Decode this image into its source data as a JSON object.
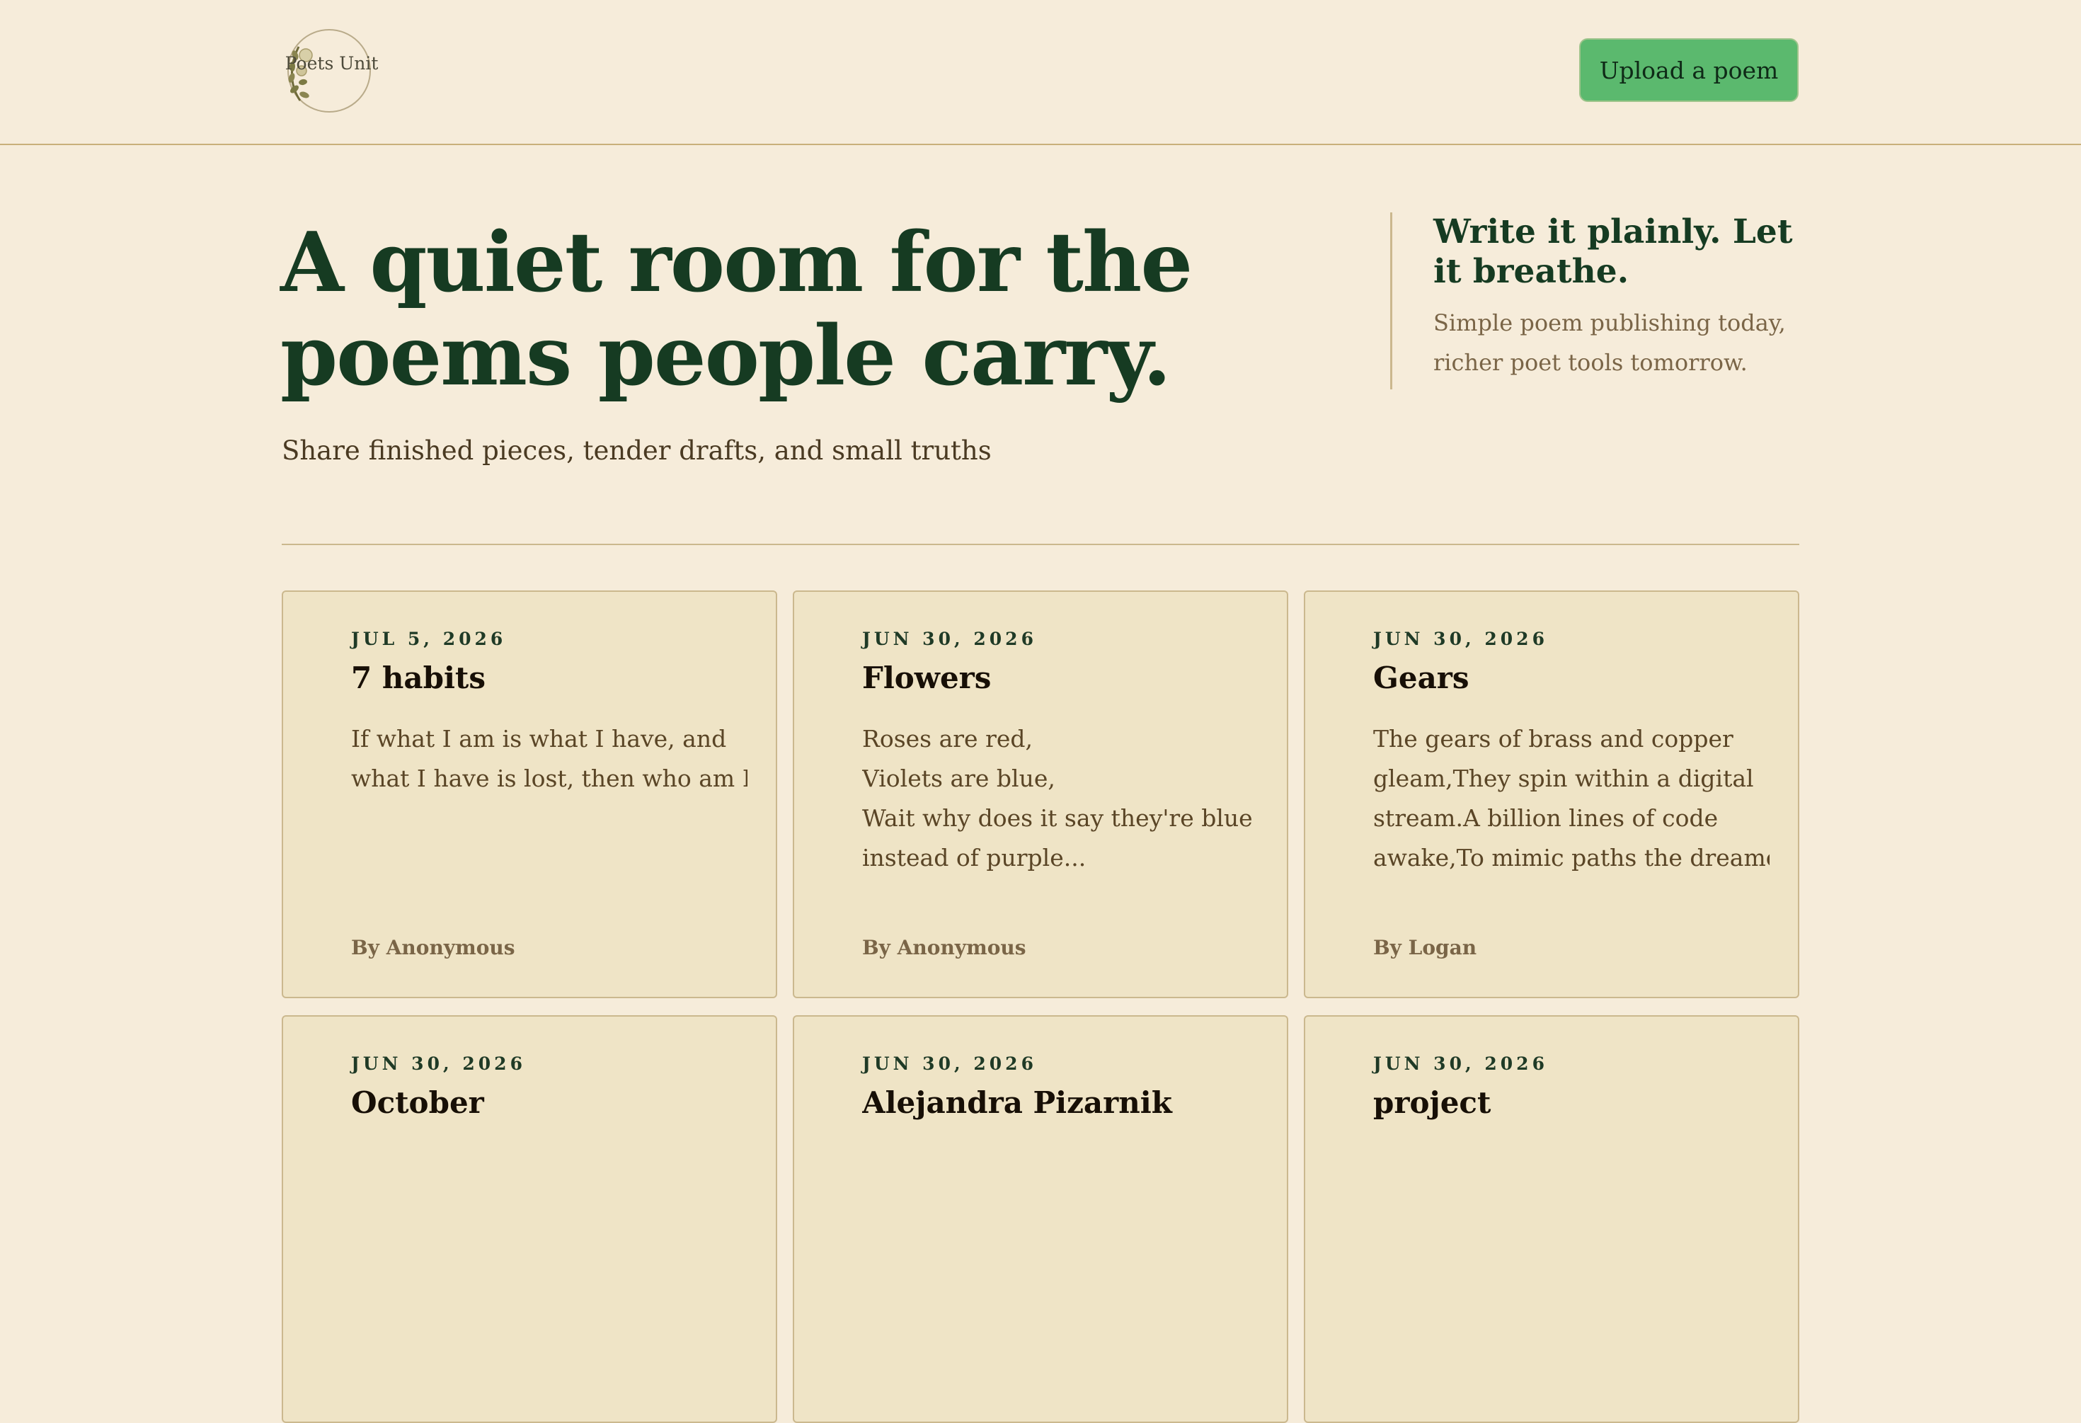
{
  "header": {
    "logo_text": "Poets United",
    "upload_label": "Upload a poem"
  },
  "hero": {
    "title_line1": "A quiet room for the",
    "title_line2": "poems people carry.",
    "subtitle": "Share finished pieces, tender drafts, and small truths"
  },
  "side_note": {
    "title_line1": "Write it plainly. Let",
    "title_line2": "it breathe.",
    "text_line1": "Simple poem publishing today,",
    "text_line2": "richer poet tools tomorrow."
  },
  "poems": [
    {
      "date": "JUL 5, 2026",
      "title": "7 habits",
      "lines": [
        "If what I am is what I have, and",
        "what I have is lost, then who am I?"
      ],
      "author": "By Anonymous"
    },
    {
      "date": "JUN 30, 2026",
      "title": "Flowers",
      "lines": [
        "Roses are red,",
        "Violets are blue,",
        "Wait why does it say they're blue",
        "instead of purple..."
      ],
      "author": "By Anonymous"
    },
    {
      "date": "JUN 30, 2026",
      "title": "Gears",
      "lines": [
        "The gears of brass and copper",
        "gleam,They spin within a digital",
        "stream.A billion lines of code",
        "awake,To mimic paths the dreame..."
      ],
      "author": "By Logan"
    },
    {
      "date": "JUN 30, 2026",
      "title": "October",
      "lines": [],
      "author": ""
    },
    {
      "date": "JUN 30, 2026",
      "title": "Alejandra Pizarnik",
      "lines": [],
      "author": ""
    },
    {
      "date": "JUN 30, 2026",
      "title": "project",
      "lines": [],
      "author": ""
    }
  ],
  "colors": {
    "background": "#f6ecda",
    "card": "#efe4c6",
    "accent_green": "#5bb96e",
    "ink_green": "#163b22",
    "border": "#cbb88e"
  }
}
